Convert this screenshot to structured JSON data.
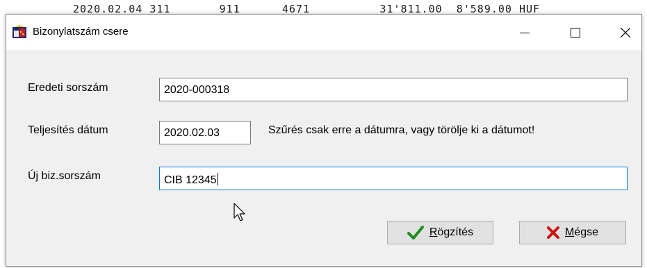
{
  "background": {
    "line_text": "2020.02.04 311       911      4671          31'811.00  8'589.00 HUF"
  },
  "window": {
    "title": "Bizonylatszám csere",
    "icon": "app-icon",
    "controls": {
      "minimize": "—",
      "maximize": "☐",
      "close": "✕"
    }
  },
  "form": {
    "original_label": "Eredeti sorszám",
    "original_value": "2020-000318",
    "date_label": "Teljesítés dátum",
    "date_value": "2020.02.03",
    "date_hint": "Szűrés csak erre a dátumra, vagy törölje ki a dátumot!",
    "new_label": "Új biz.sorszám",
    "new_value": "CIB 12345"
  },
  "buttons": {
    "save_label_first": "R",
    "save_label_rest": "ögzítés",
    "cancel_label_first": "M",
    "cancel_label_rest": "égse"
  },
  "colors": {
    "focus_border": "#0078d7",
    "check_green": "#1e8c1e",
    "cross_red": "#d01010"
  }
}
